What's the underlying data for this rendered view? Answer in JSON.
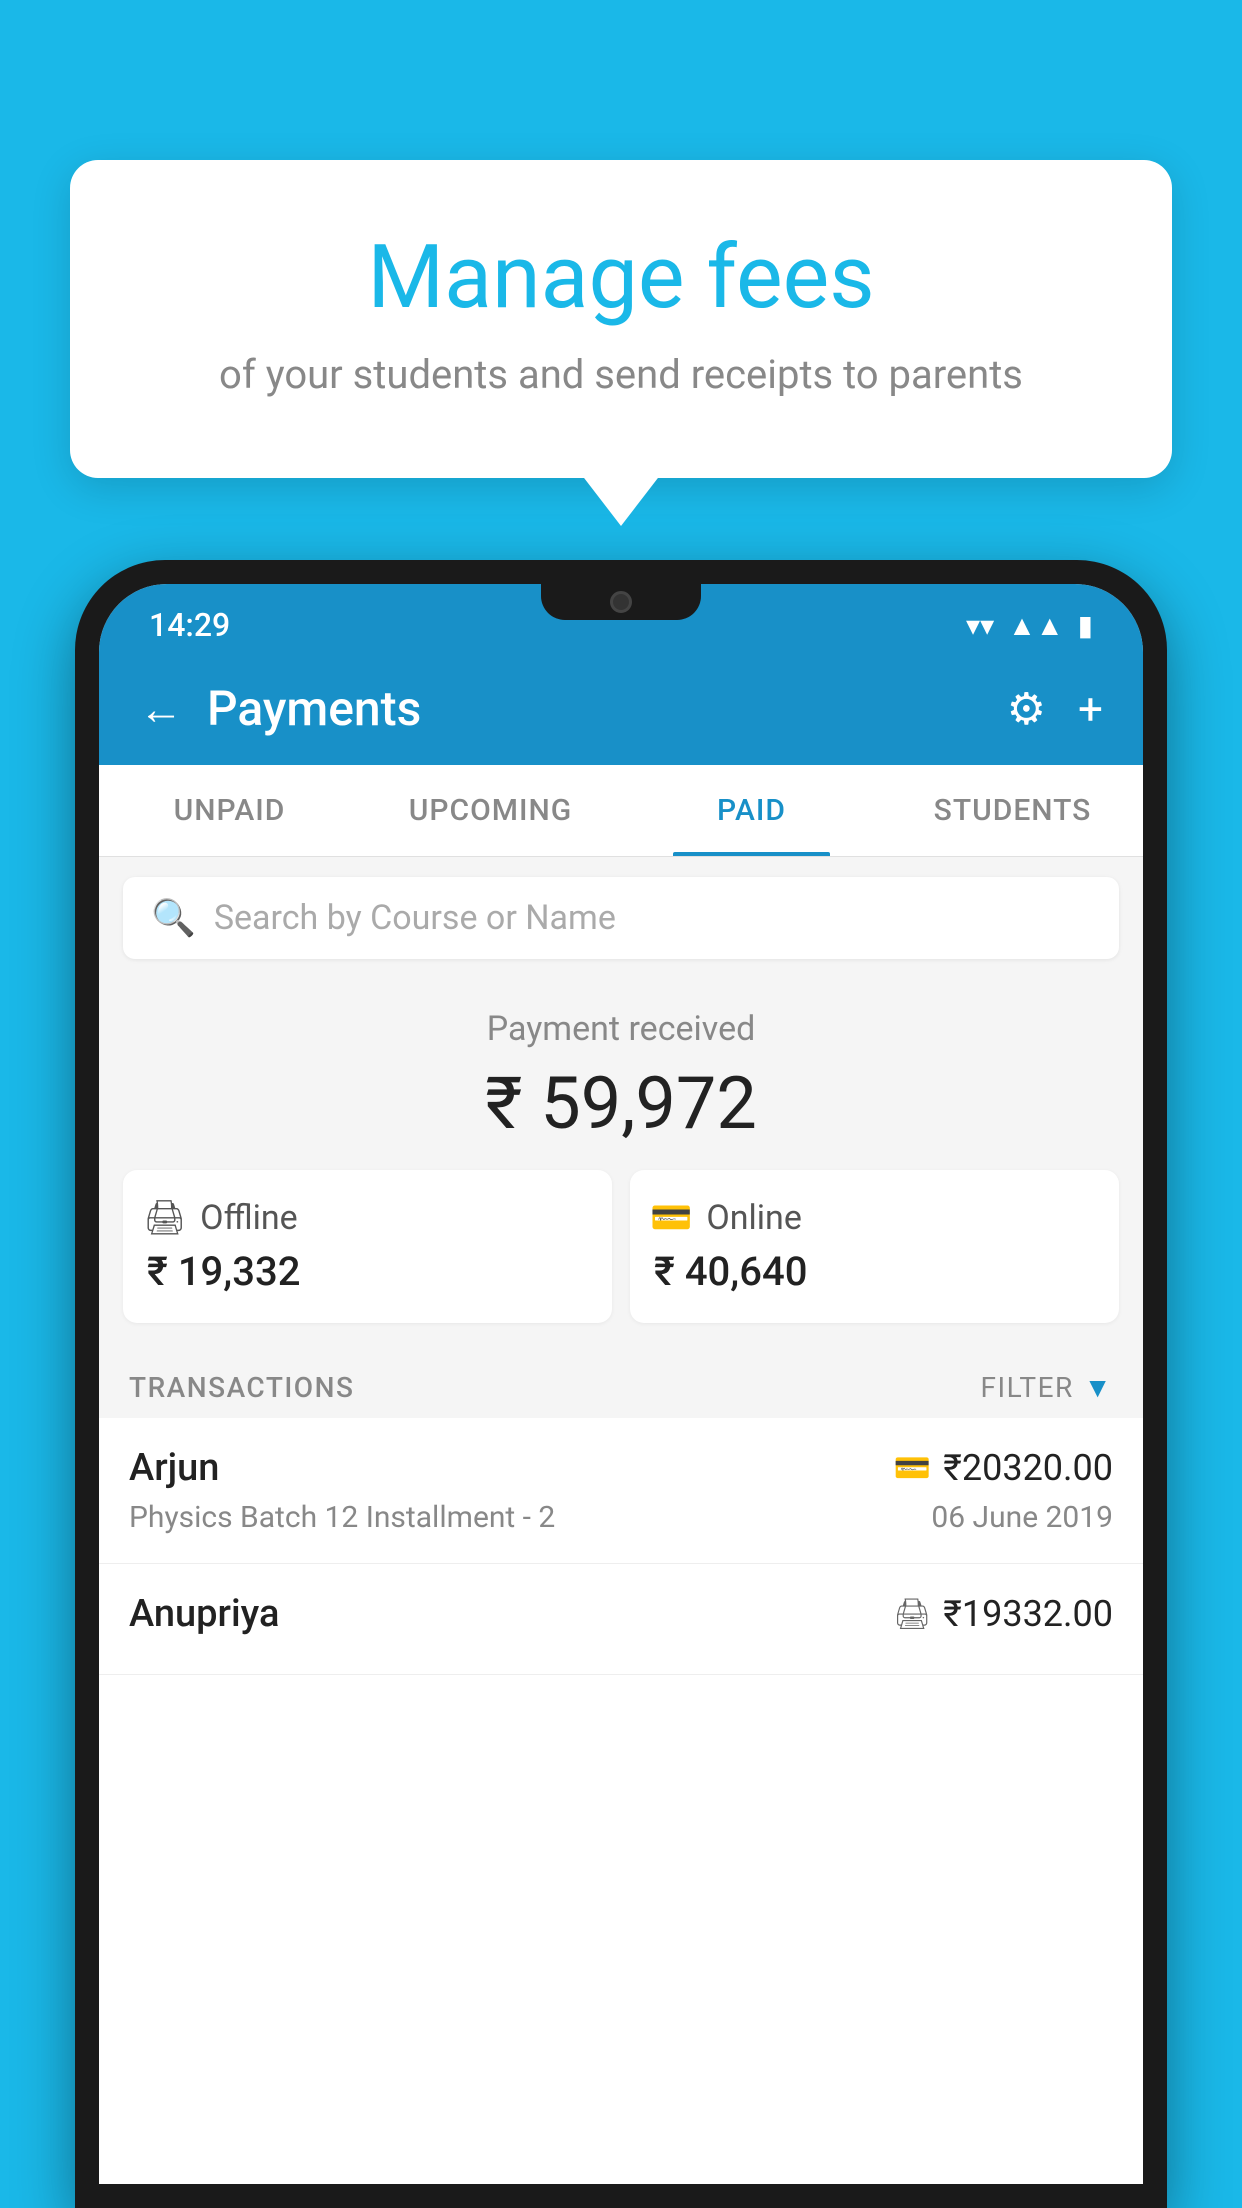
{
  "background_color": "#1ab8e8",
  "tooltip": {
    "title": "Manage fees",
    "subtitle": "of your students and send receipts to parents"
  },
  "status_bar": {
    "time": "14:29",
    "icons": [
      "wifi",
      "signal",
      "battery"
    ]
  },
  "header": {
    "title": "Payments",
    "back_label": "←",
    "settings_icon": "⚙",
    "add_icon": "+"
  },
  "tabs": [
    {
      "label": "UNPAID",
      "active": false
    },
    {
      "label": "UPCOMING",
      "active": false
    },
    {
      "label": "PAID",
      "active": true
    },
    {
      "label": "STUDENTS",
      "active": false
    }
  ],
  "search": {
    "placeholder": "Search by Course or Name"
  },
  "payment_received": {
    "label": "Payment received",
    "amount": "₹ 59,972",
    "offline": {
      "icon_label": "Offline",
      "amount": "₹ 19,332"
    },
    "online": {
      "icon_label": "Online",
      "amount": "₹ 40,640"
    }
  },
  "transactions": {
    "label": "TRANSACTIONS",
    "filter_label": "FILTER",
    "items": [
      {
        "name": "Arjun",
        "amount": "₹20320.00",
        "course": "Physics Batch 12 Installment - 2",
        "date": "06 June 2019",
        "payment_type": "online"
      },
      {
        "name": "Anupriya",
        "amount": "₹19332.00",
        "course": "",
        "date": "",
        "payment_type": "offline"
      }
    ]
  }
}
